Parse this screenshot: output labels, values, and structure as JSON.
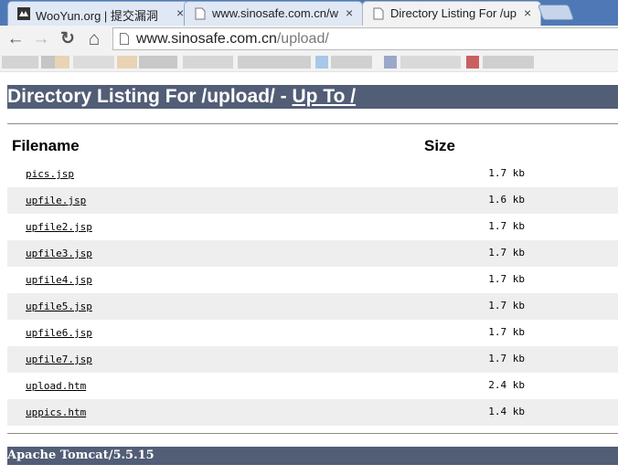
{
  "tabs": [
    {
      "title": "WooYun.org | 提交漏洞",
      "active": false
    },
    {
      "title": "www.sinosafe.com.cn/w",
      "active": false
    },
    {
      "title": "Directory Listing For /up",
      "active": true
    }
  ],
  "close_glyph": "×",
  "toolbar": {
    "back_glyph": "←",
    "forward_glyph": "→",
    "reload_glyph": "↻",
    "home_glyph": "⌂",
    "url_host": "www.sinosafe.com.cn",
    "url_path": "/upload/"
  },
  "bookmark_blur_colors": [
    "#c8c8c8",
    "#d6d6d6",
    "#e8d3b5",
    "#cfcfcf",
    "#a9c7e8",
    "#9aa8c9",
    "#d9d9d9",
    "#c96060",
    "#cfcfcf"
  ],
  "listing": {
    "heading_prefix": "Directory Listing For /upload/ - ",
    "up_link": "Up To /",
    "col_filename": "Filename",
    "col_size": "Size",
    "files": [
      {
        "name": "pics.jsp",
        "size": "1.7 kb"
      },
      {
        "name": "upfile.jsp",
        "size": "1.6 kb"
      },
      {
        "name": "upfile2.jsp",
        "size": "1.7 kb"
      },
      {
        "name": "upfile3.jsp",
        "size": "1.7 kb"
      },
      {
        "name": "upfile4.jsp",
        "size": "1.7 kb"
      },
      {
        "name": "upfile5.jsp",
        "size": "1.7 kb"
      },
      {
        "name": "upfile6.jsp",
        "size": "1.7 kb"
      },
      {
        "name": "upfile7.jsp",
        "size": "1.7 kb"
      },
      {
        "name": "upload.htm",
        "size": "2.4 kb"
      },
      {
        "name": "uppics.htm",
        "size": "1.4 kb"
      }
    ],
    "footer": "Apache Tomcat/5.5.15"
  },
  "colors": {
    "tomcat_banner": "#525d76",
    "row_alt": "#eeeeee",
    "tabbar": "#4f79b6"
  }
}
